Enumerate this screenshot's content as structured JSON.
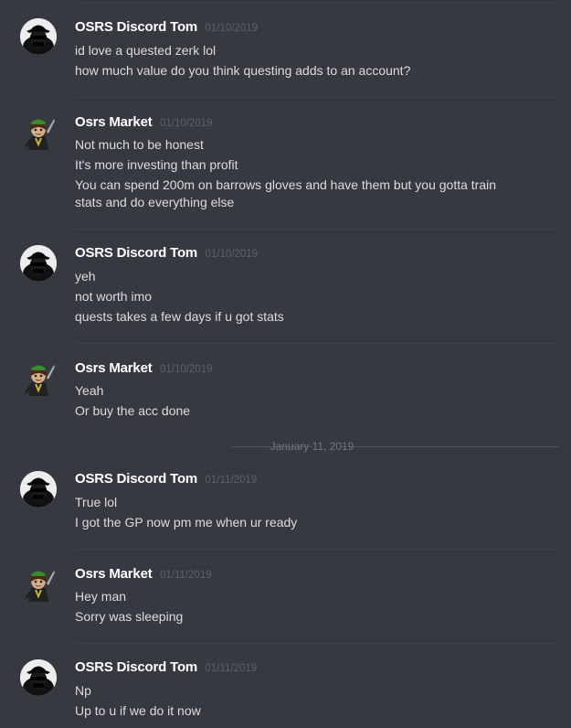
{
  "users": {
    "tom": {
      "name": "OSRS Discord Tom"
    },
    "market": {
      "name": "Osrs Market"
    }
  },
  "messages": [
    {
      "user": "OSRS Discord Tom",
      "time": "01/10/2019",
      "lines": [
        "id love a quested zerk lol",
        "how much value do you think questing adds to an account?"
      ]
    },
    {
      "user": "Osrs Market",
      "time": "01/10/2019",
      "lines": [
        "Not much to be honest",
        "It's more investing than profit",
        "You can spend 200m on barrows gloves and have them but you gotta train",
        "stats and do everything else"
      ]
    },
    {
      "user": "OSRS Discord Tom",
      "time": "01/10/2019",
      "lines": [
        "yeh",
        "not worth imo",
        "quests takes a few days if u got stats"
      ]
    },
    {
      "user": "Osrs Market",
      "time": "01/10/2019",
      "lines": [
        "Yeah",
        "Or buy the acc done"
      ]
    },
    {
      "user": "OSRS Discord Tom",
      "time": "01/11/2019",
      "lines": [
        "True lol",
        "I got the GP now pm me when ur ready"
      ]
    },
    {
      "user": "Osrs Market",
      "time": "01/11/2019",
      "lines": [
        "Hey man",
        "Sorry was sleeping"
      ]
    },
    {
      "user": "OSRS Discord Tom",
      "time": "01/11/2019",
      "lines": [
        "Np",
        "Up to u if we do it now"
      ]
    }
  ],
  "date_divider": "January 11, 2019",
  "colors": {
    "background": "#36393f",
    "username": "#ffffff",
    "timestamp": "#5d6066",
    "text": "#dcddde",
    "divider": "#40434a"
  }
}
